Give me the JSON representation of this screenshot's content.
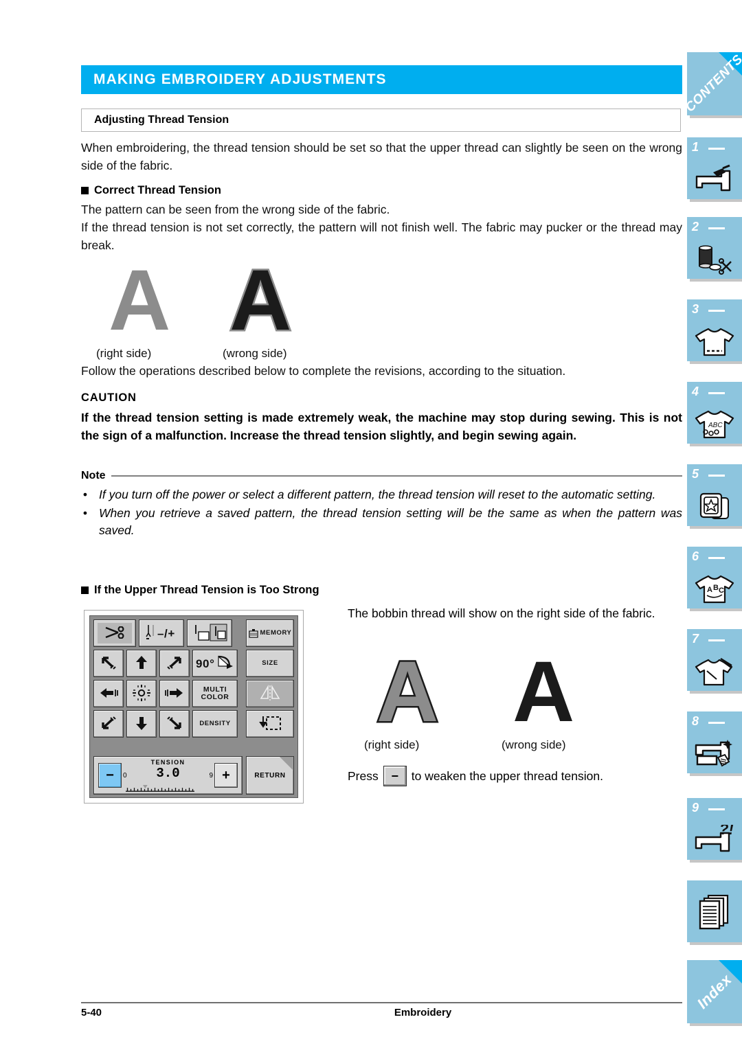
{
  "header": {
    "chapter_title": "MAKING EMBROIDERY ADJUSTMENTS",
    "section_title": "Adjusting Thread Tension"
  },
  "body": {
    "intro": "When embroidering, the thread tension should be set so that the upper thread can slightly be seen on the wrong side of the fabric.",
    "correct_heading": "Correct Thread Tension",
    "correct_text": "The pattern can be seen from the wrong side of the fabric.\nIf the thread tension is not set correctly, the pattern will not finish well.  The fabric may pucker or the thread may break.",
    "correct_text_line1": "The pattern can be seen from the wrong side of the fabric.",
    "correct_text_line2": "If the thread tension is not set correctly, the pattern will not finish well.  The fabric may pucker or the thread may break.",
    "follow_text": "Follow the operations described below to complete the revisions, according to the situation."
  },
  "figures": {
    "upper": {
      "letter": "A",
      "caption_left": "(right side)",
      "caption_right": "(wrong side)"
    },
    "lower": {
      "letter": "A",
      "caption_left": "(right side)",
      "caption_right": "(wrong side)"
    }
  },
  "caution": {
    "heading": "CAUTION",
    "text": "If the thread tension setting is made extremely weak, the machine may stop during sewing. This is not the sign of a malfunction. Increase the thread tension slightly, and begin sewing again."
  },
  "note": {
    "title": "Note",
    "bullet": "•",
    "items": [
      "If you turn off the power or select a different pattern, the thread tension will reset to the automatic setting.",
      "When you retrieve a saved pattern, the thread tension setting will be the same as when the pattern was saved."
    ]
  },
  "too_strong": {
    "heading": "If the Upper Thread Tension is Too Strong",
    "description": "The bobbin thread will show on the right side of the fabric.",
    "press_prefix": "Press",
    "press_key_label": "−",
    "press_suffix": "to weaken the upper thread tension."
  },
  "lcd": {
    "keys_row1": [
      {
        "name": "thread-cutter-key",
        "label": ""
      },
      {
        "name": "needle-position-key",
        "label": "−/+"
      },
      {
        "name": "needle-stop-position-key",
        "label": ""
      },
      {
        "name": "memory-key",
        "label": "MEMORY"
      }
    ],
    "keys_row2": [
      {
        "name": "move-up-left-key",
        "label": ""
      },
      {
        "name": "move-up-key",
        "label": ""
      },
      {
        "name": "move-up-right-key",
        "label": ""
      },
      {
        "name": "rotate-90-key",
        "label": "90°"
      },
      {
        "name": "size-key",
        "label": "SIZE"
      }
    ],
    "keys_row3": [
      {
        "name": "move-left-key",
        "label": ""
      },
      {
        "name": "center-key",
        "label": ""
      },
      {
        "name": "move-right-key",
        "label": ""
      },
      {
        "name": "multi-color-key",
        "label": "MULTI\nCOLOR"
      },
      {
        "name": "mirror-image-key",
        "label": ""
      }
    ],
    "keys_row3_multicolor_line1": "MULTI",
    "keys_row3_multicolor_line2": "COLOR",
    "keys_row4": [
      {
        "name": "move-down-left-key",
        "label": ""
      },
      {
        "name": "move-down-key",
        "label": ""
      },
      {
        "name": "move-down-right-key",
        "label": ""
      },
      {
        "name": "density-key",
        "label": "DENSITY"
      },
      {
        "name": "trial-key",
        "label": ""
      }
    ],
    "tension": {
      "label": "TENSION",
      "value": "3.0",
      "min": "0",
      "max": "9",
      "minus": "−",
      "plus": "+"
    },
    "return_label": "RETURN",
    "rotate_label": "90°",
    "size_label": "SIZE",
    "density_label": "DENSITY",
    "memory_label": "MEMORY"
  },
  "tabs": [
    {
      "name": "contents",
      "num": "",
      "text": "CONTENTS",
      "icon": "contents-corner"
    },
    {
      "name": "chapter-1",
      "num": "1",
      "text": "",
      "icon": "sewing-machine-icon"
    },
    {
      "name": "chapter-2",
      "num": "2",
      "text": "",
      "icon": "spool-bobbin-scissors-icon"
    },
    {
      "name": "chapter-3",
      "num": "3",
      "text": "",
      "icon": "shirt-stitch-icon"
    },
    {
      "name": "chapter-4",
      "num": "4",
      "text": "",
      "icon": "shirt-abc-icon"
    },
    {
      "name": "chapter-5",
      "num": "5",
      "text": "",
      "icon": "embroidery-hoop-star-icon"
    },
    {
      "name": "chapter-6",
      "num": "6",
      "text": "",
      "icon": "shirt-letters-icon"
    },
    {
      "name": "chapter-7",
      "num": "7",
      "text": "",
      "icon": "shirt-needle-icon"
    },
    {
      "name": "chapter-8",
      "num": "8",
      "text": "",
      "icon": "machine-sparkle-icon"
    },
    {
      "name": "chapter-9",
      "num": "9",
      "text": "",
      "icon": "machine-question-icon"
    },
    {
      "name": "appendix",
      "num": "",
      "text": "",
      "icon": "documents-icon"
    },
    {
      "name": "index",
      "num": "",
      "text": "Index",
      "icon": "index-corner"
    }
  ],
  "footer": {
    "page_number": "5-40",
    "section_name": "Embroidery"
  },
  "colors": {
    "accent_blue": "#00AEEF",
    "tab_blue": "#8DC5DE",
    "key_gray": "#D4D4D4",
    "minus_key_blue": "#7EC8F4"
  }
}
